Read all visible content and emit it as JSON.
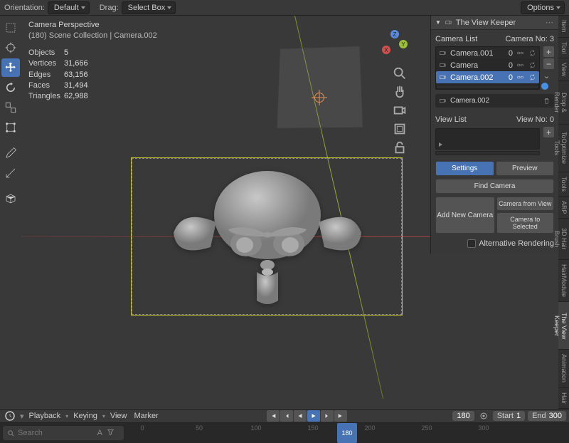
{
  "header": {
    "orientation_label": "Orientation:",
    "orientation_value": "Default",
    "drag_label": "Drag:",
    "drag_value": "Select Box",
    "options": "Options"
  },
  "overlay": {
    "title": "Camera Perspective",
    "crumb": "(180) Scene Collection | Camera.002"
  },
  "stats": {
    "objects": {
      "label": "Objects",
      "value": "5"
    },
    "vertices": {
      "label": "Vertices",
      "value": "31,666"
    },
    "edges": {
      "label": "Edges",
      "value": "63,156"
    },
    "faces": {
      "label": "Faces",
      "value": "31,494"
    },
    "triangles": {
      "label": "Triangles",
      "value": "62,988"
    }
  },
  "gizmo": {
    "z": "Z",
    "y": "Y",
    "x": "X"
  },
  "panel": {
    "title": "The View Keeper",
    "camlist_label": "Camera List",
    "camno_label": "Camera No:",
    "camno_value": "3",
    "cams": [
      {
        "name": "Camera.001",
        "count": "0"
      },
      {
        "name": "Camera",
        "count": "0"
      },
      {
        "name": "Camera.002",
        "count": "0"
      }
    ],
    "selected_cam": "Camera.002",
    "viewlist_label": "View List",
    "viewno_label": "View No:",
    "viewno_value": "0",
    "settings_btn": "Settings",
    "preview_btn": "Preview",
    "find_camera_btn": "Find Camera",
    "add_camera_btn": "Add New Camera",
    "camera_from_view_btn": "Camera from View",
    "camera_to_selected_btn": "Camera to Selected",
    "alt_render_cb": "Alternative Rendering"
  },
  "tabs": [
    "Item",
    "Tool",
    "View",
    "Drop & Render",
    "ToOptimize Tools",
    "Tools",
    "ARP",
    "3D Hair Brush",
    "HairModule",
    "The View Keeper",
    "Animation",
    "Hair"
  ],
  "timeline": {
    "playback": "Playback",
    "keying": "Keying",
    "view": "View",
    "marker": "Marker",
    "search_placeholder": "Search",
    "ticks": [
      "0",
      "50",
      "100",
      "150",
      "200",
      "250",
      "300"
    ],
    "current_frame": "180",
    "start_label": "Start",
    "start_value": "1",
    "end_label": "End",
    "end_value": "300"
  }
}
